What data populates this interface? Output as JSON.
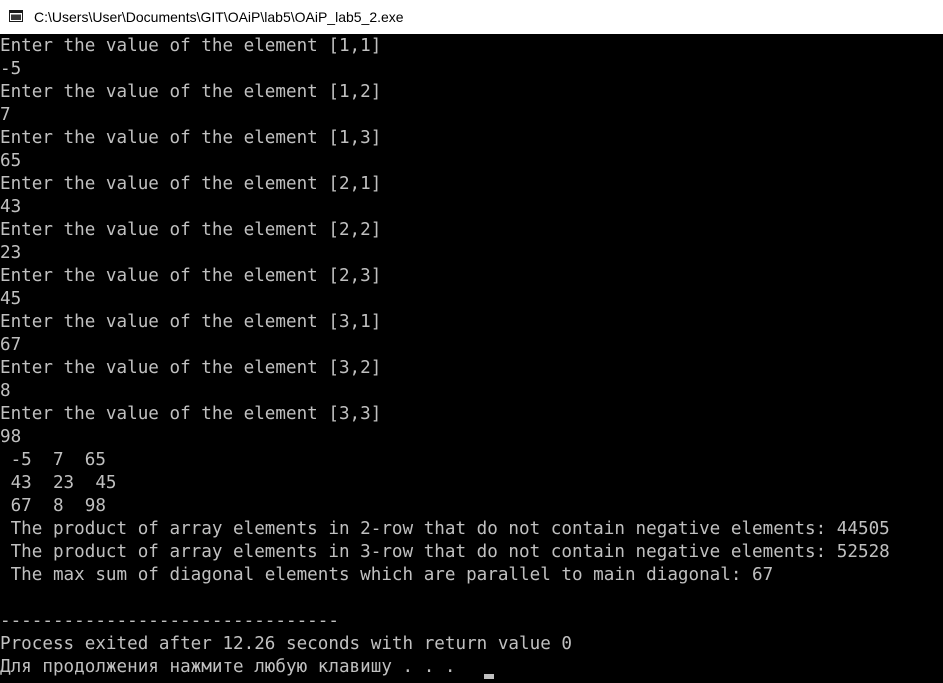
{
  "window": {
    "title": "C:\\Users\\User\\Documents\\GIT\\OAiP\\lab5\\OAiP_lab5_2.exe",
    "app_icon": "console-window-icon"
  },
  "console": {
    "lines": [
      "Enter the value of the element [1,1]",
      "-5",
      "Enter the value of the element [1,2]",
      "7",
      "Enter the value of the element [1,3]",
      "65",
      "Enter the value of the element [2,1]",
      "43",
      "Enter the value of the element [2,2]",
      "23",
      "Enter the value of the element [2,3]",
      "45",
      "Enter the value of the element [3,1]",
      "67",
      "Enter the value of the element [3,2]",
      "8",
      "Enter the value of the element [3,3]",
      "98",
      " -5  7  65",
      " 43  23  45",
      " 67  8  98",
      " The product of array elements in 2-row that do not contain negative elements: 44505",
      " The product of array elements in 3-row that do not contain negative elements: 52528",
      " The max sum of diagonal elements which are parallel to main diagonal: 67",
      "",
      "--------------------------------",
      "Process exited after 12.26 seconds with return value 0",
      "Для продолжения нажмите любую клавишу . . . "
    ],
    "text_color": "#c0c0c0",
    "background_color": "#000000"
  }
}
